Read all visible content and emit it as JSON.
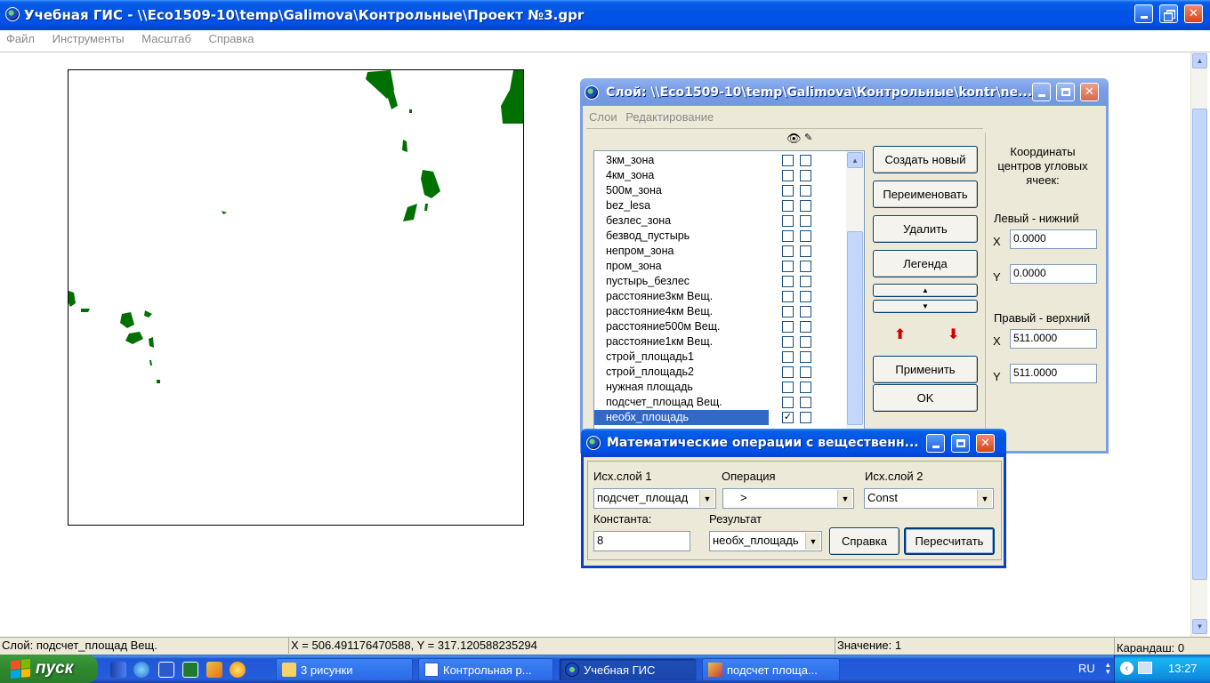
{
  "main_window": {
    "title": "Учебная ГИС - \\\\Eco1509-10\\temp\\Galimova\\Контрольные\\Проект №3.gpr",
    "menu": [
      "Файл",
      "Инструменты",
      "Масштаб",
      "Справка"
    ]
  },
  "layer_window": {
    "title": "Слой: \\\\Eco1509-10\\temp\\Galimova\\Контрольные\\kontr\\ne...",
    "menu": [
      "Слои",
      "Редактирование"
    ],
    "layers": [
      {
        "name": "3км_зона",
        "visible": false
      },
      {
        "name": "4км_зона",
        "visible": false
      },
      {
        "name": "500м_зона",
        "visible": false
      },
      {
        "name": "bez_lesa",
        "visible": false
      },
      {
        "name": "безлес_зона",
        "visible": false
      },
      {
        "name": "безвод_пустырь",
        "visible": false
      },
      {
        "name": "непром_зона",
        "visible": false
      },
      {
        "name": "пром_зона",
        "visible": false
      },
      {
        "name": "пустырь_безлес",
        "visible": false
      },
      {
        "name": "расстояние3км Вещ.",
        "visible": false
      },
      {
        "name": "расстояние4км Вещ.",
        "visible": false
      },
      {
        "name": "расстояние500м Вещ.",
        "visible": false
      },
      {
        "name": "расстояние1км Вещ.",
        "visible": false
      },
      {
        "name": "строй_площадь1",
        "visible": false
      },
      {
        "name": "строй_площадь2",
        "visible": false
      },
      {
        "name": "нужная площадь",
        "visible": false
      },
      {
        "name": "подсчет_площад Вещ.",
        "visible": false
      },
      {
        "name": "необх_площадь",
        "visible": true,
        "selected": true
      }
    ],
    "buttons": {
      "create": "Создать новый",
      "rename": "Переименовать",
      "delete": "Удалить",
      "legend": "Легенда",
      "apply": "Применить",
      "ok": "OK"
    },
    "coords": {
      "header": "Координаты центров угловых ячеек:",
      "lower_left": "Левый - нижний",
      "upper_right": "Правый - верхний",
      "x_label": "X",
      "y_label": "Y",
      "ll_x": "0.0000",
      "ll_y": "0.0000",
      "ur_x": "511.0000",
      "ur_y": "511.0000"
    }
  },
  "math_dialog": {
    "title": "Математические операции с вещественн...",
    "src1_label": "Исх.слой 1",
    "src1_value": "подсчет_площад",
    "op_label": "Операция",
    "op_value": ">",
    "src2_label": "Исх.слой 2",
    "src2_value": "Const",
    "const_label": "Константа:",
    "const_value": "8",
    "result_label": "Результат",
    "result_value": "необх_площадь",
    "help_button": "Справка",
    "recalc_button": "Пересчитать"
  },
  "status_bar": {
    "layer": "Слой: подсчет_площад  Вещ.",
    "coords": "X = 506.491176470588, Y = 317.120588235294",
    "value": "Значение: 1",
    "pencil": "Карандаш: 0"
  },
  "taskbar": {
    "start": "пуск",
    "tasks": [
      "3 рисунки",
      "Контрольная р...",
      "Учебная ГИС",
      "подсчет площа..."
    ],
    "lang": "RU",
    "time": "13:27"
  },
  "colors": {
    "map_fill": "#007000",
    "title_blue": "#0054e3",
    "selection": "#316ac5"
  }
}
